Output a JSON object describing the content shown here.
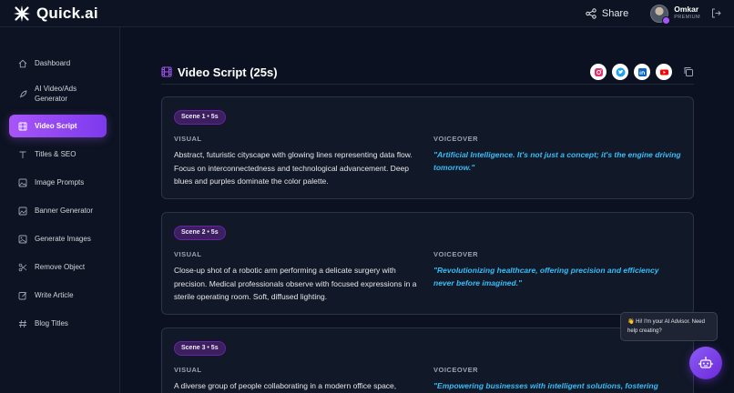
{
  "app": {
    "name": "Quick.ai"
  },
  "topbar": {
    "share_label": "Share",
    "user_name": "Omkar",
    "user_plan": "PREMIUM"
  },
  "sidebar": {
    "items": [
      {
        "label": "Dashboard",
        "icon": "home-icon"
      },
      {
        "label": "AI Video/Ads Generator",
        "icon": "rocket-icon"
      },
      {
        "label": "Video Script",
        "icon": "film-icon",
        "active": true
      },
      {
        "label": "Titles & SEO",
        "icon": "text-icon"
      },
      {
        "label": "Image Prompts",
        "icon": "image-icon"
      },
      {
        "label": "Banner Generator",
        "icon": "banner-icon"
      },
      {
        "label": "Generate Images",
        "icon": "image-icon"
      },
      {
        "label": "Remove Object",
        "icon": "scissors-icon"
      },
      {
        "label": "Write Article",
        "icon": "edit-icon"
      },
      {
        "label": "Blog Titles",
        "icon": "hash-icon"
      }
    ]
  },
  "main": {
    "title": "Video Script (25s)",
    "social_icons": [
      "instagram-icon",
      "twitter-icon",
      "linkedin-icon",
      "youtube-icon"
    ],
    "scenes": [
      {
        "badge": "Scene 1 • 5s",
        "visual_label": "VISUAL",
        "voiceover_label": "VOICEOVER",
        "visual": "Abstract, futuristic cityscape with glowing lines representing data flow. Focus on interconnectedness and technological advancement. Deep blues and purples dominate the color palette.",
        "voiceover": "\"Artificial Intelligence. It's not just a concept; it's the engine driving tomorrow.\""
      },
      {
        "badge": "Scene 2 • 5s",
        "visual_label": "VISUAL",
        "voiceover_label": "VOICEOVER",
        "visual": "Close-up shot of a robotic arm performing a delicate surgery with precision. Medical professionals observe with focused expressions in a sterile operating room. Soft, diffused lighting.",
        "voiceover": "\"Revolutionizing healthcare, offering precision and efficiency never before imagined.\""
      },
      {
        "badge": "Scene 3 • 5s",
        "visual_label": "VISUAL",
        "voiceover_label": "VOICEOVER",
        "visual": "A diverse group of people collaborating in a modern office space,",
        "voiceover": "\"Empowering businesses with intelligent solutions, fostering"
      }
    ]
  },
  "chat": {
    "message": "👋 Hi! I'm your AI Advisor. Need help creating?"
  },
  "colors": {
    "accent": "#a855f7",
    "voiceover": "#38bdf8",
    "background": "#0b1120"
  }
}
